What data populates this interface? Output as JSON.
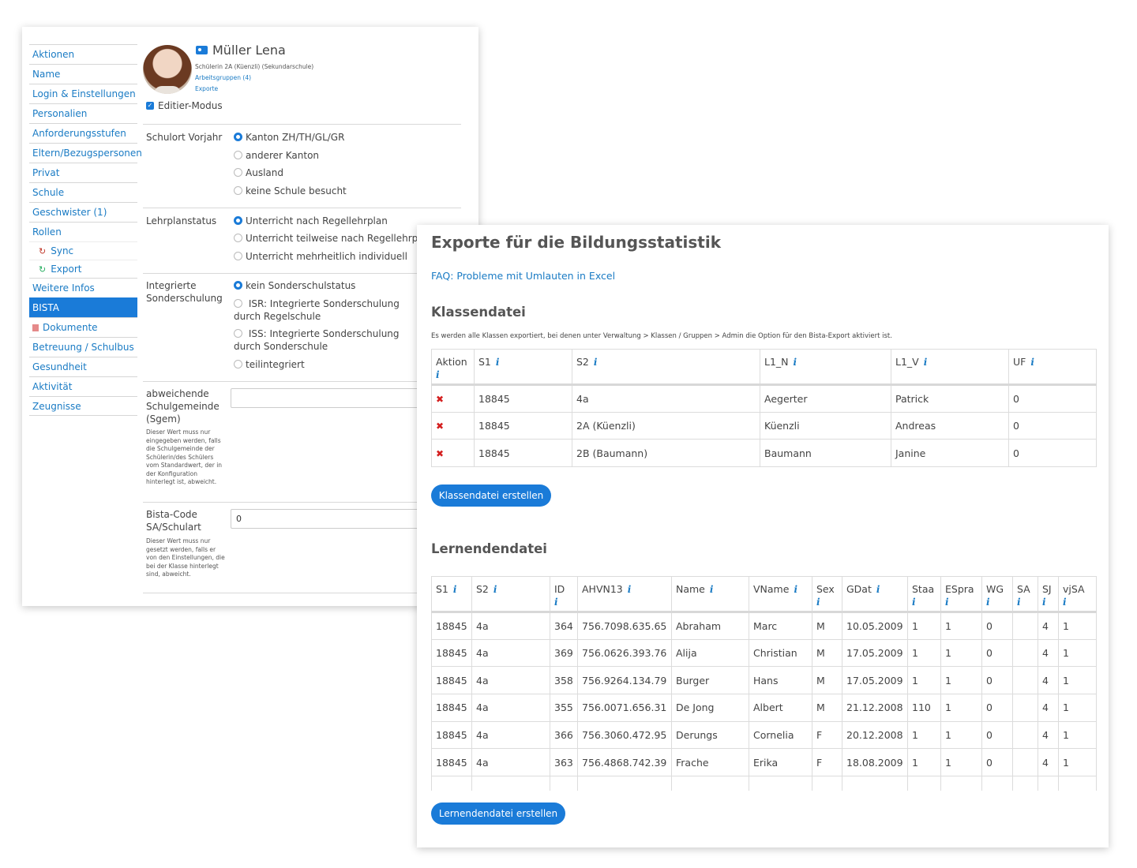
{
  "profile": {
    "sidebar": {
      "items": [
        {
          "label": "Aktionen"
        },
        {
          "label": "Name"
        },
        {
          "label": "Login & Einstellungen"
        },
        {
          "label": "Personalien"
        },
        {
          "label": "Anforderungsstufen"
        },
        {
          "label": "Eltern/Bezugspersonen"
        },
        {
          "label": "Privat"
        },
        {
          "label": "Schule"
        },
        {
          "label": "Geschwister (1)"
        },
        {
          "label": "Rollen"
        },
        {
          "label": "Sync",
          "icon": "sync-icon"
        },
        {
          "label": "Export",
          "icon": "export-icon"
        },
        {
          "label": "Weitere Infos"
        },
        {
          "label": "BISTA",
          "active": true
        },
        {
          "label": "Dokumente",
          "icon": "document-icon"
        },
        {
          "label": "Betreuung / Schulbus"
        },
        {
          "label": "Gesundheit"
        },
        {
          "label": "Aktivität"
        },
        {
          "label": "Zeugnisse"
        }
      ]
    },
    "name": "Müller Lena",
    "subtitle": "Schülerin 2A (Küenzli) (Sekundarschule)",
    "link_groups": "Arbeitsgruppen (4)",
    "link_exports": "Exporte",
    "edit_mode": "Editier-Modus",
    "fields": {
      "schulort": {
        "label": "Schulort Vorjahr",
        "options": [
          "Kanton ZH/TH/GL/GR",
          "anderer Kanton",
          "Ausland",
          "keine Schule besucht"
        ],
        "selected": 0
      },
      "lehrplan": {
        "label": "Lehrplanstatus",
        "options": [
          "Unterricht nach Regellehrplan",
          "Unterricht teilweise nach Regellehrplan",
          "Unterricht mehrheitlich individuell"
        ],
        "selected": 0
      },
      "sonder": {
        "label_1": "Integrierte",
        "label_2": "Sonderschulung",
        "options": [
          "kein Sonderschulstatus",
          "ISR: Integrierte Sonderschulung durch Regelschule",
          "ISS: Integrierte Sonderschulung durch Sonderschule",
          "teilintegriert"
        ],
        "selected": 0
      },
      "sgem": {
        "label_1": "abweichende",
        "label_2": "Schulgemeinde",
        "label_3": "(Sgem)",
        "hint": "Dieser Wert muss nur eingegeben werden, falls die Schulgemeinde der Schülerin/des Schülers vom Standardwert, der in der Konfiguration hinterlegt ist, abweicht.",
        "value": ""
      },
      "bista_code": {
        "label_1": "Bista-Code",
        "label_2": "SA/Schulart",
        "hint": "Dieser Wert muss nur gesetzt werden, falls er von den Einstellungen, die bei der Klasse hinterlegt sind, abweicht.",
        "value": "0"
      }
    }
  },
  "exports": {
    "title": "Exporte für die Bildungsstatistik",
    "faq": "FAQ: Probleme mit Umlauten in Excel",
    "klassen": {
      "heading": "Klassendatei",
      "note": "Es werden alle Klassen exportiert, bei denen unter Verwaltung > Klassen / Gruppen > Admin die Option für den Bista-Export aktiviert ist.",
      "columns": [
        "Aktion",
        "S1",
        "S2",
        "L1_N",
        "L1_V",
        "UF"
      ],
      "rows": [
        [
          "18845",
          "4a",
          "Aegerter",
          "Patrick",
          "0"
        ],
        [
          "18845",
          "2A (Küenzli)",
          "Küenzli",
          "Andreas",
          "0"
        ],
        [
          "18845",
          "2B (Baumann)",
          "Baumann",
          "Janine",
          "0"
        ]
      ],
      "button": "Klassendatei erstellen"
    },
    "lernende": {
      "heading": "Lernendendatei",
      "columns": [
        "S1",
        "S2",
        "ID",
        "AHVN13",
        "Name",
        "VName",
        "Sex",
        "GDat",
        "Staa",
        "ESpra",
        "WG",
        "SA",
        "SJ",
        "vjSA"
      ],
      "rows": [
        [
          "18845",
          "4a",
          "364",
          "756.7098.635.65",
          "Abraham",
          "Marc",
          "M",
          "10.05.2009",
          "1",
          "1",
          "0",
          "",
          "4",
          "1"
        ],
        [
          "18845",
          "4a",
          "369",
          "756.0626.393.76",
          "Alija",
          "Christian",
          "M",
          "17.05.2009",
          "1",
          "1",
          "0",
          "",
          "4",
          "1"
        ],
        [
          "18845",
          "4a",
          "358",
          "756.9264.134.79",
          "Burger",
          "Hans",
          "M",
          "17.05.2009",
          "1",
          "1",
          "0",
          "",
          "4",
          "1"
        ],
        [
          "18845",
          "4a",
          "355",
          "756.0071.656.31",
          "De Jong",
          "Albert",
          "M",
          "21.12.2008",
          "110",
          "1",
          "0",
          "",
          "4",
          "1"
        ],
        [
          "18845",
          "4a",
          "366",
          "756.3060.472.95",
          "Derungs",
          "Cornelia",
          "F",
          "20.12.2008",
          "1",
          "1",
          "0",
          "",
          "4",
          "1"
        ],
        [
          "18845",
          "4a",
          "363",
          "756.4868.742.39",
          "Frache",
          "Erika",
          "F",
          "18.08.2009",
          "1",
          "1",
          "0",
          "",
          "4",
          "1"
        ]
      ],
      "button": "Lernendendatei erstellen"
    }
  },
  "colors": {
    "accent": "#1a7bd8",
    "link": "#1a7bc4",
    "delete": "#d41f1f"
  }
}
